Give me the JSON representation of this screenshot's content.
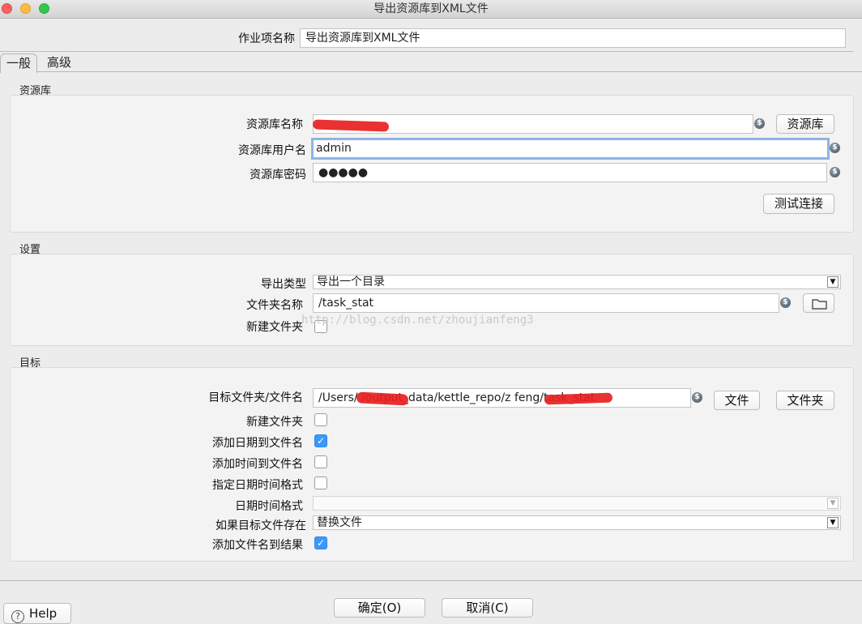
{
  "window": {
    "title": "导出资源库到XML文件"
  },
  "job_name": {
    "label": "作业项名称",
    "value": "导出资源库到XML文件"
  },
  "tabs": [
    {
      "label": "一般"
    },
    {
      "label": "高级"
    }
  ],
  "repository": {
    "title": "资源库",
    "name_label": "资源库名称",
    "name_value": "",
    "repo_button": "资源库",
    "user_label": "资源库用户名",
    "user_value": "admin",
    "password_label": "资源库密码",
    "password_value": "●●●●●",
    "test_button": "测试连接"
  },
  "settings": {
    "title": "设置",
    "export_type_label": "导出类型",
    "export_type_value": "导出一个目录",
    "folder_label": "文件夹名称",
    "folder_value": "/task_stat",
    "new_folder_label": "新建文件夹"
  },
  "target": {
    "title": "目标",
    "file_label": "目标文件夹/文件名",
    "file_value": "/Users/            /output_data/kettle_repo/z          feng/task_stat",
    "file_button": "文件",
    "folder_button": "文件夹",
    "create_folder_label": "新建文件夹",
    "create_folder_checked": false,
    "add_date_label": "添加日期到文件名",
    "add_date_checked": true,
    "add_time_label": "添加时间到文件名",
    "add_time_checked": false,
    "specify_format_label": "指定日期时间格式",
    "specify_format_checked": false,
    "datetime_format_label": "日期时间格式",
    "datetime_format_value": "",
    "if_exists_label": "如果目标文件存在",
    "if_exists_value": "替换文件",
    "add_to_result_label": "添加文件名到结果",
    "add_to_result_checked": true
  },
  "watermark": "http://blog.csdn.net/zhoujianfeng3",
  "buttons": {
    "ok": "确定(O)",
    "cancel": "取消(C)",
    "help": "Help"
  },
  "colors": {
    "accent": "#3b99fc",
    "focus_ring": "#8fb3e6",
    "redaction": "#e82020"
  }
}
